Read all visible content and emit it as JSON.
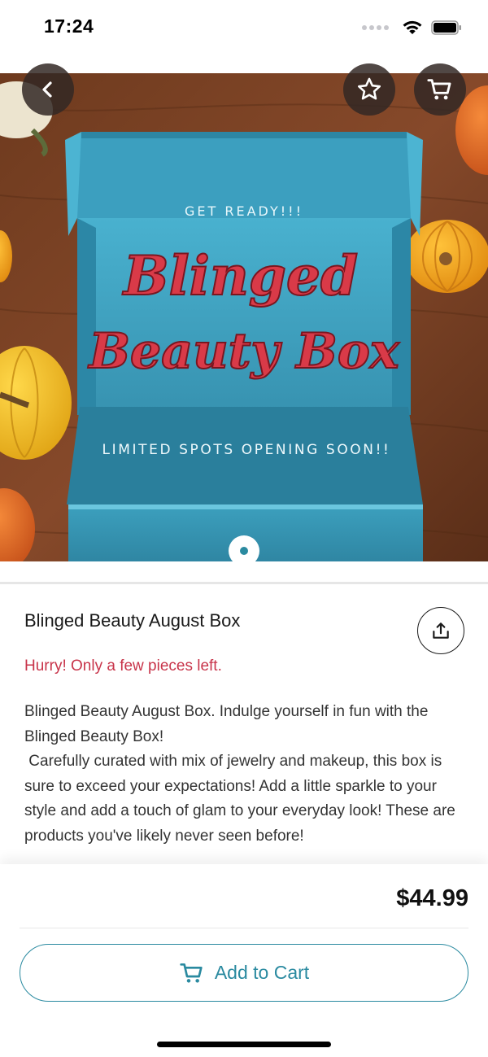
{
  "status_bar": {
    "time": "17:24"
  },
  "hero": {
    "top_text": "GET READY!!!",
    "script_line_1": "Blinged",
    "script_line_2": "Beauty Box",
    "bottom_text": "LIMITED SPOTS OPENING SOON!!"
  },
  "nav": {
    "back_icon": "chevron-left",
    "favorite_icon": "star",
    "cart_icon": "cart"
  },
  "product": {
    "title": "Blinged Beauty August Box",
    "stock_note": "Hurry! Only a few pieces left.",
    "description": "Blinged Beauty August Box. Indulge yourself in fun with the Blinged Beauty Box!\n Carefully curated with mix of jewelry and makeup, this box is sure to exceed your expectations! Add a little sparkle to your style and add a touch of glam to your everyday look! These are products you've likely never seen before!"
  },
  "purchase": {
    "price": "$44.99",
    "add_to_cart_label": "Add to Cart"
  },
  "colors": {
    "accent": "#2a8aa0",
    "stock_warning": "#c8344a",
    "box_teal": "#3ea6c4",
    "script_red": "#d93a48"
  }
}
